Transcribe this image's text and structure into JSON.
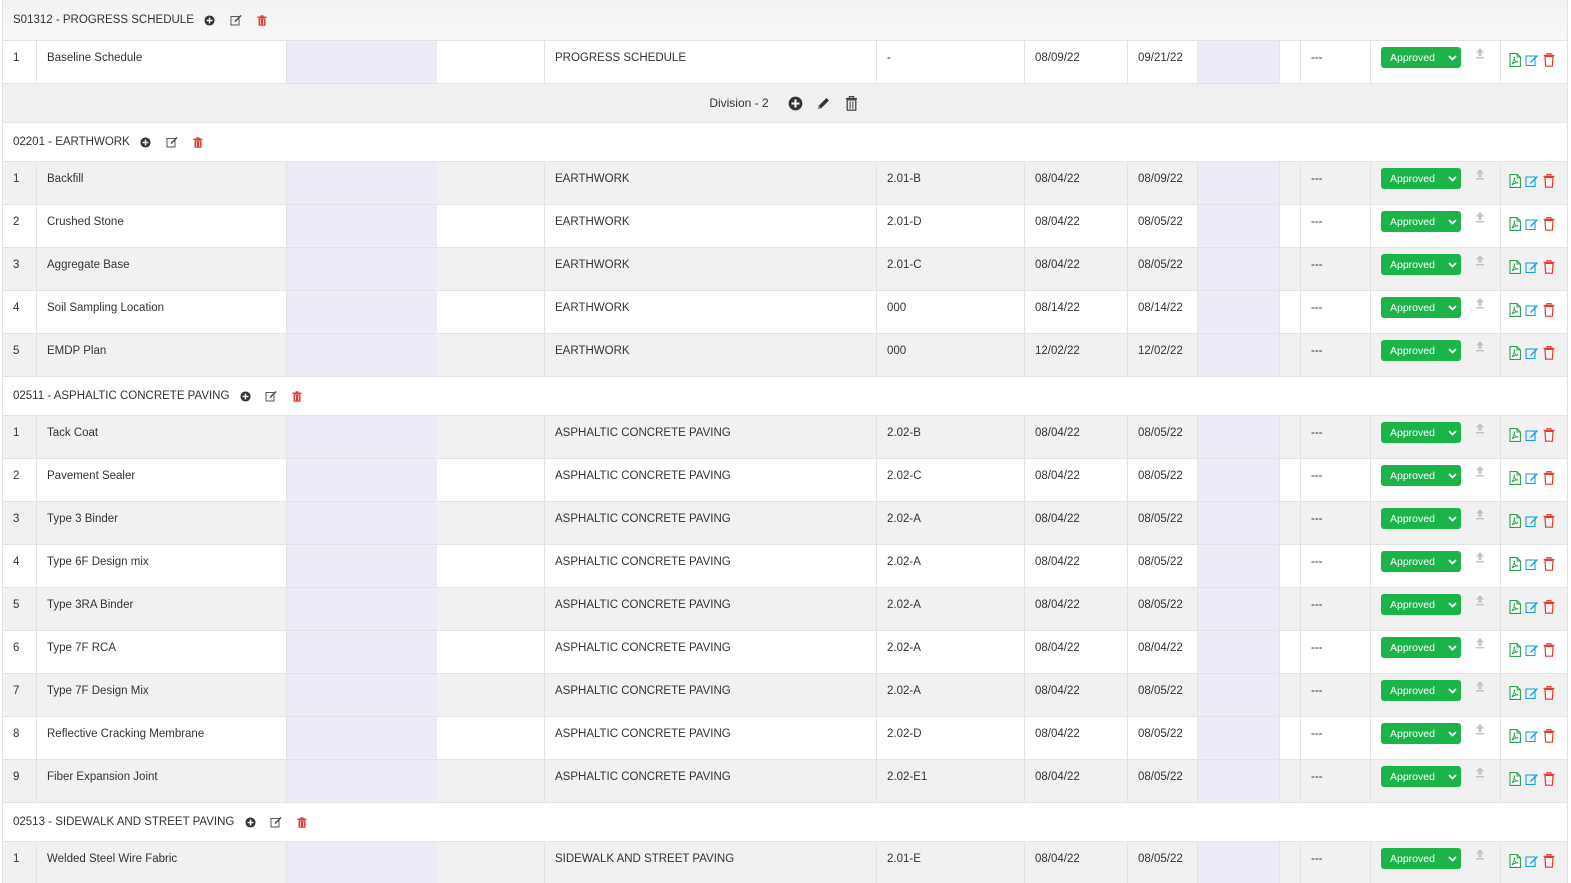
{
  "colors": {
    "approved": "#1bb34a",
    "delete": "#e53935",
    "edit": "#18a0d8",
    "pdf": "#2e9e4f",
    "placeholder_col": "#ececf9"
  },
  "sections": [
    {
      "kind": "section",
      "title": "S01312 - PROGRESS SCHEDULE",
      "first": true,
      "rows": [
        {
          "num": "1",
          "name": "Baseline Schedule",
          "spec": "PROGRESS SCHEDULE",
          "code": "-",
          "date1": "08/09/22",
          "date2": "09/21/22",
          "dash": "---",
          "status": "Approved"
        }
      ]
    },
    {
      "kind": "division",
      "label": "Division - 2"
    },
    {
      "kind": "section",
      "title": "02201 - EARTHWORK",
      "rows": [
        {
          "num": "1",
          "name": "Backfill",
          "spec": "EARTHWORK",
          "code": "2.01-B",
          "date1": "08/04/22",
          "date2": "08/09/22",
          "dash": "---",
          "status": "Approved"
        },
        {
          "num": "2",
          "name": "Crushed Stone",
          "spec": "EARTHWORK",
          "code": "2.01-D",
          "date1": "08/04/22",
          "date2": "08/05/22",
          "dash": "---",
          "status": "Approved"
        },
        {
          "num": "3",
          "name": "Aggregate Base",
          "spec": "EARTHWORK",
          "code": "2.01-C",
          "date1": "08/04/22",
          "date2": "08/05/22",
          "dash": "---",
          "status": "Approved"
        },
        {
          "num": "4",
          "name": "Soil Sampling Location",
          "spec": "EARTHWORK",
          "code": "000",
          "date1": "08/14/22",
          "date2": "08/14/22",
          "dash": "---",
          "status": "Approved"
        },
        {
          "num": "5",
          "name": "EMDP Plan",
          "spec": "EARTHWORK",
          "code": "000",
          "date1": "12/02/22",
          "date2": "12/02/22",
          "dash": "---",
          "status": "Approved"
        }
      ]
    },
    {
      "kind": "section",
      "title": "02511 - ASPHALTIC CONCRETE PAVING",
      "rows": [
        {
          "num": "1",
          "name": "Tack Coat",
          "spec": "ASPHALTIC CONCRETE PAVING",
          "code": "2.02-B",
          "date1": "08/04/22",
          "date2": "08/05/22",
          "dash": "---",
          "status": "Approved"
        },
        {
          "num": "2",
          "name": "Pavement Sealer",
          "spec": "ASPHALTIC CONCRETE PAVING",
          "code": "2.02-C",
          "date1": "08/04/22",
          "date2": "08/05/22",
          "dash": "---",
          "status": "Approved"
        },
        {
          "num": "3",
          "name": "Type 3 Binder",
          "spec": "ASPHALTIC CONCRETE PAVING",
          "code": "2.02-A",
          "date1": "08/04/22",
          "date2": "08/05/22",
          "dash": "---",
          "status": "Approved"
        },
        {
          "num": "4",
          "name": "Type 6F Design mix",
          "spec": "ASPHALTIC CONCRETE PAVING",
          "code": "2.02-A",
          "date1": "08/04/22",
          "date2": "08/05/22",
          "dash": "---",
          "status": "Approved"
        },
        {
          "num": "5",
          "name": "Type 3RA Binder",
          "spec": "ASPHALTIC CONCRETE PAVING",
          "code": "2.02-A",
          "date1": "08/04/22",
          "date2": "08/05/22",
          "dash": "---",
          "status": "Approved"
        },
        {
          "num": "6",
          "name": "Type 7F RCA",
          "spec": "ASPHALTIC CONCRETE PAVING",
          "code": "2.02-A",
          "date1": "08/04/22",
          "date2": "08/04/22",
          "dash": "---",
          "status": "Approved"
        },
        {
          "num": "7",
          "name": "Type 7F Design Mix",
          "spec": "ASPHALTIC CONCRETE PAVING",
          "code": "2.02-A",
          "date1": "08/04/22",
          "date2": "08/05/22",
          "dash": "---",
          "status": "Approved"
        },
        {
          "num": "8",
          "name": "Reflective Cracking Membrane",
          "spec": "ASPHALTIC CONCRETE PAVING",
          "code": "2.02-D",
          "date1": "08/04/22",
          "date2": "08/05/22",
          "dash": "---",
          "status": "Approved"
        },
        {
          "num": "9",
          "name": "Fiber Expansion Joint",
          "spec": "ASPHALTIC CONCRETE PAVING",
          "code": "2.02-E1",
          "date1": "08/04/22",
          "date2": "08/05/22",
          "dash": "---",
          "status": "Approved"
        }
      ]
    },
    {
      "kind": "section",
      "title": "02513 - SIDEWALK AND STREET PAVING",
      "rows": [
        {
          "num": "1",
          "name": "Welded Steel Wire Fabric",
          "spec": "SIDEWALK AND STREET PAVING",
          "code": "2.01-E",
          "date1": "08/04/22",
          "date2": "08/05/22",
          "dash": "---",
          "status": "Approved"
        }
      ]
    }
  ]
}
